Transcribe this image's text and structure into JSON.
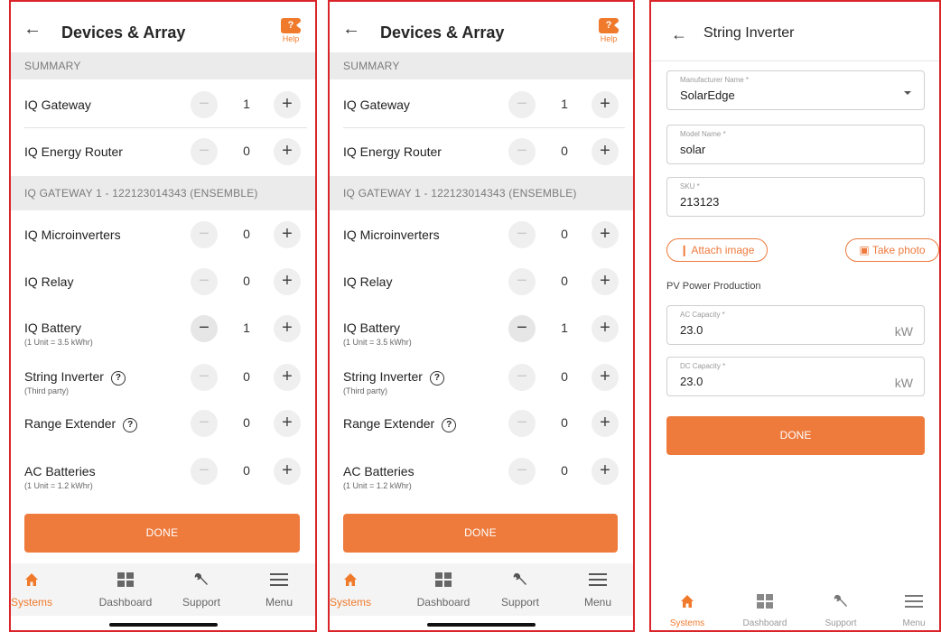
{
  "screens": [
    {
      "header": {
        "title": "Devices & Array",
        "help_label": "Help",
        "help_glyph": "?"
      },
      "summary": {
        "label": "SUMMARY",
        "rows": [
          {
            "name": "IQ Gateway",
            "count": "1"
          },
          {
            "name": "IQ Energy Router",
            "count": "0"
          }
        ]
      },
      "gateway": {
        "label": "IQ GATEWAY 1 - 122123014343 (ENSEMBLE)",
        "rows": [
          {
            "name": "IQ Microinverters",
            "sub": "",
            "count": "0"
          },
          {
            "name": "IQ Relay",
            "sub": "",
            "count": "0"
          },
          {
            "name": "IQ Battery",
            "sub": "(1 Unit = 3.5 kWhr)",
            "count": "1"
          },
          {
            "name": "String Inverter",
            "sub": "(Third party)",
            "count": "0"
          },
          {
            "name": "Range Extender",
            "sub": "",
            "count": "0"
          },
          {
            "name": "AC Batteries",
            "sub": "(1 Unit = 1.2 kWhr)",
            "count": "0"
          }
        ]
      },
      "done_label": "DONE"
    },
    {
      "header": {
        "title": "Devices & Array",
        "help_label": "Help",
        "help_glyph": "?"
      },
      "summary": {
        "label": "SUMMARY",
        "rows": [
          {
            "name": "IQ Gateway",
            "count": "1"
          },
          {
            "name": "IQ Energy Router",
            "count": "0"
          }
        ]
      },
      "gateway": {
        "label": "IQ GATEWAY 1 - 122123014343 (ENSEMBLE)",
        "rows": [
          {
            "name": "IQ Microinverters",
            "sub": "",
            "count": "0"
          },
          {
            "name": "IQ Relay",
            "sub": "",
            "count": "0"
          },
          {
            "name": "IQ Battery",
            "sub": "(1 Unit = 3.5 kWhr)",
            "count": "1"
          },
          {
            "name": "String Inverter",
            "sub": "(Third party)",
            "count": "0"
          },
          {
            "name": "Range Extender",
            "sub": "",
            "count": "0"
          },
          {
            "name": "AC Batteries",
            "sub": "(1 Unit = 1.2 kWhr)",
            "count": "0"
          }
        ]
      },
      "done_label": "DONE"
    }
  ],
  "nav": {
    "items": [
      {
        "label": "Systems",
        "icon": "home-icon"
      },
      {
        "label": "Dashboard",
        "icon": "dashboard-icon"
      },
      {
        "label": "Support",
        "icon": "wrench-icon"
      },
      {
        "label": "Menu",
        "icon": "menu-icon"
      }
    ],
    "active": "Systems"
  },
  "string_inverter": {
    "title": "String Inverter",
    "manufacturer": {
      "label": "Manufacturer Name *",
      "value": "SolarEdge"
    },
    "model": {
      "label": "Model Name *",
      "value": "solar"
    },
    "sku": {
      "label": "SKU *",
      "value": "213123"
    },
    "attach_label": "Attach image",
    "photo_label": "Take photo",
    "pv_section": "PV Power Production",
    "ac": {
      "label": "AC Capacity *",
      "value": "23.0",
      "unit": "kW"
    },
    "dc": {
      "label": "DC Capacity *",
      "value": "23.0",
      "unit": "kW"
    },
    "done_label": "DONE"
  },
  "colors": {
    "accent": "#ee7a3c",
    "frame": "#d9252a",
    "section_bg": "#ebebeb"
  }
}
